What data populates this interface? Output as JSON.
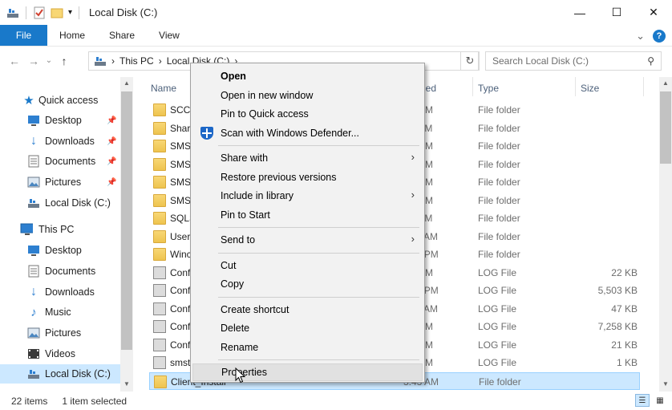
{
  "window": {
    "title": "Local Disk (C:)",
    "controls": {
      "minimize": "—",
      "maximize": "☐",
      "close": "✕"
    }
  },
  "ribbon": {
    "tabs": [
      "File",
      "Home",
      "Share",
      "View"
    ],
    "collapse_glyph": "⌄",
    "help_glyph": "?"
  },
  "address": {
    "path": [
      "This PC",
      "Local Disk (C:)"
    ],
    "separator": "›",
    "search_placeholder": "Search Local Disk (C:)"
  },
  "nav": {
    "quick_access": "Quick access",
    "quick_items": [
      {
        "label": "Desktop",
        "icon": "desktop-icon",
        "pinned": true
      },
      {
        "label": "Downloads",
        "icon": "downloads-icon",
        "pinned": true
      },
      {
        "label": "Documents",
        "icon": "documents-icon",
        "pinned": true
      },
      {
        "label": "Pictures",
        "icon": "pictures-icon",
        "pinned": true
      },
      {
        "label": "Local Disk (C:)",
        "icon": "drive-icon",
        "pinned": false
      }
    ],
    "this_pc": "This PC",
    "pc_items": [
      {
        "label": "Desktop",
        "icon": "desktop-icon"
      },
      {
        "label": "Documents",
        "icon": "documents-icon"
      },
      {
        "label": "Downloads",
        "icon": "downloads-icon"
      },
      {
        "label": "Music",
        "icon": "music-icon"
      },
      {
        "label": "Pictures",
        "icon": "pictures-icon"
      },
      {
        "label": "Videos",
        "icon": "videos-icon"
      },
      {
        "label": "Local Disk (C:)",
        "icon": "drive-icon",
        "selected": true
      }
    ]
  },
  "columns": {
    "name": "Name",
    "modified": "ied",
    "type": "Type",
    "size": "Size"
  },
  "files": [
    {
      "name": "SCCI",
      "modified": ":48 PM",
      "type": "File folder",
      "size": "",
      "kind": "folder"
    },
    {
      "name": "Shar",
      "modified": ":46 AM",
      "type": "File folder",
      "size": "",
      "kind": "folder"
    },
    {
      "name": "SMS",
      "modified": ":44 PM",
      "type": "File folder",
      "size": "",
      "kind": "folder"
    },
    {
      "name": "SMS",
      "modified": ":50 PM",
      "type": "File folder",
      "size": "",
      "kind": "folder"
    },
    {
      "name": "SMS",
      "modified": ":42 PM",
      "type": "File folder",
      "size": "",
      "kind": "folder"
    },
    {
      "name": "SMS",
      "modified": ":50 PM",
      "type": "File folder",
      "size": "",
      "kind": "folder"
    },
    {
      "name": "SQLS",
      "modified": ":00 AM",
      "type": "File folder",
      "size": "",
      "kind": "folder"
    },
    {
      "name": "User",
      "modified": "1:41 AM",
      "type": "File folder",
      "size": "",
      "kind": "folder"
    },
    {
      "name": "Winc",
      "modified": "2:41 PM",
      "type": "File folder",
      "size": "",
      "kind": "folder"
    },
    {
      "name": "Conf",
      "modified": ":00 PM",
      "type": "LOG File",
      "size": "22 KB",
      "kind": "log"
    },
    {
      "name": "Conf",
      "modified": "2:59 PM",
      "type": "LOG File",
      "size": "5,503 KB",
      "kind": "log"
    },
    {
      "name": "Conf",
      "modified": "1:43 AM",
      "type": "LOG File",
      "size": "47 KB",
      "kind": "log"
    },
    {
      "name": "Conf",
      "modified": ":02 PM",
      "type": "LOG File",
      "size": "7,258 KB",
      "kind": "log"
    },
    {
      "name": "Conf",
      "modified": ":02 PM",
      "type": "LOG File",
      "size": "21 KB",
      "kind": "log"
    },
    {
      "name": "smst",
      "modified": ":02 PM",
      "type": "LOG File",
      "size": "1 KB",
      "kind": "log"
    },
    {
      "name": "Client_Install",
      "modified": "3:43 AM",
      "type": "File folder",
      "size": "",
      "kind": "folder",
      "selected": true
    }
  ],
  "context_menu": {
    "items": [
      {
        "label": "Open",
        "bold": true
      },
      {
        "label": "Open in new window"
      },
      {
        "label": "Pin to Quick access"
      },
      {
        "label": "Scan with Windows Defender...",
        "icon": "shield-icon"
      },
      {
        "sep": true
      },
      {
        "label": "Share with",
        "submenu": true
      },
      {
        "label": "Restore previous versions"
      },
      {
        "label": "Include in library",
        "submenu": true
      },
      {
        "label": "Pin to Start"
      },
      {
        "sep": true
      },
      {
        "label": "Send to",
        "submenu": true
      },
      {
        "sep": true
      },
      {
        "label": "Cut"
      },
      {
        "label": "Copy"
      },
      {
        "sep": true
      },
      {
        "label": "Create shortcut"
      },
      {
        "label": "Delete"
      },
      {
        "label": "Rename"
      },
      {
        "sep": true
      },
      {
        "label": "Properties",
        "hover": true
      }
    ],
    "submenu_glyph": "›"
  },
  "status": {
    "count": "22 items",
    "selection": "1 item selected"
  },
  "colors": {
    "accent": "#1979ca",
    "selected_bg": "#cce8ff",
    "folder": "#f8d775"
  }
}
